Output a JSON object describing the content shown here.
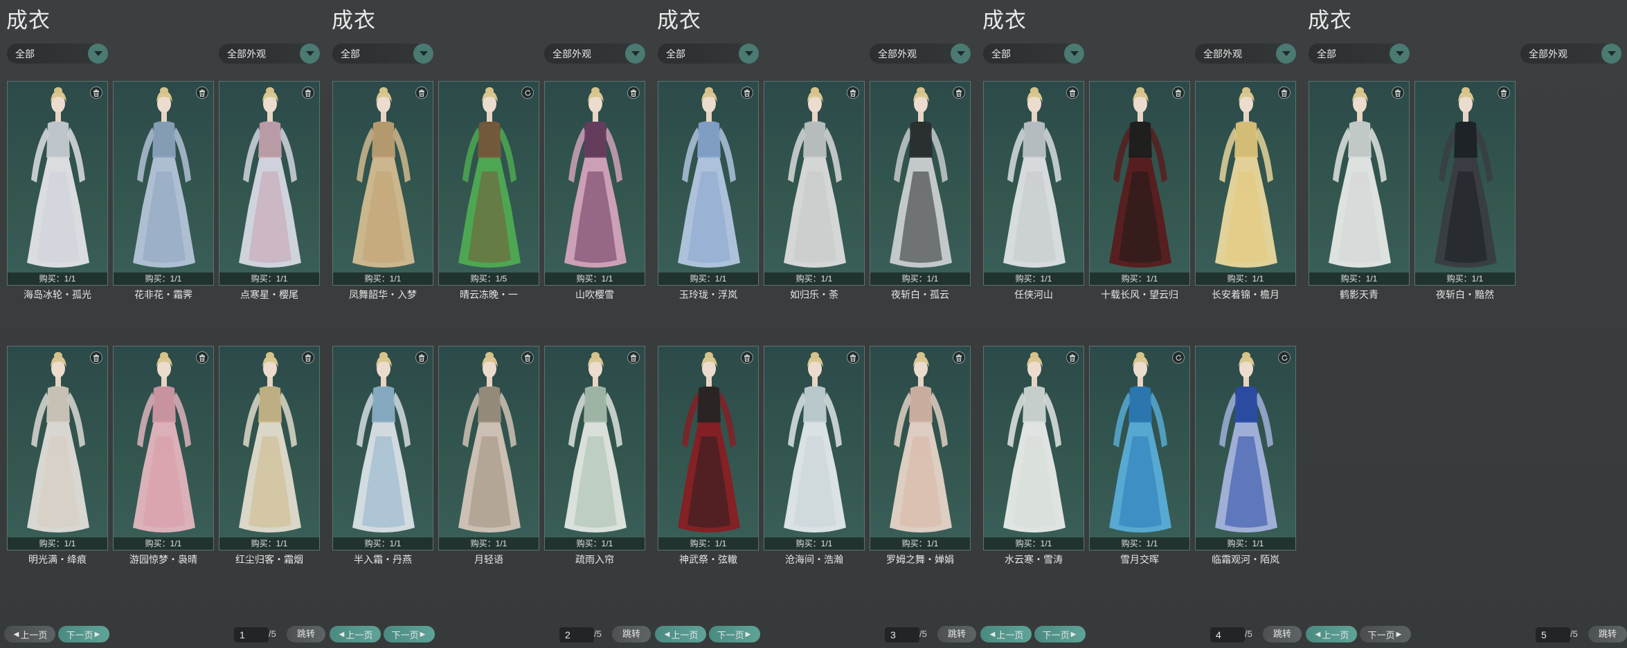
{
  "colors": {
    "background": "#3a3d3e",
    "card_bg": "#2f504c",
    "accent_teal": "#4a7a72",
    "next_button": "#5fa398"
  },
  "icons": {
    "trash_badge": "trash-icon",
    "refresh_badge": "refresh-icon",
    "dropdown": "chevron-down-icon"
  },
  "panels": [
    {
      "title": "成衣",
      "filter_category": "全部",
      "filter_appearance": "全部外观",
      "page_current": "1",
      "page_total": "/5",
      "prev_label": "上一页",
      "next_label": "下一页",
      "jump_label": "跳转",
      "active_nav": "next",
      "items": [
        {
          "name": "海岛冰轮・孤光",
          "purchase": "购买：1/1",
          "badge": "trash",
          "palette": [
            "#e8e8ec",
            "#cdd0d8"
          ]
        },
        {
          "name": "花非花・霜霁",
          "purchase": "购买：1/1",
          "badge": "trash",
          "palette": [
            "#b9c8dc",
            "#8ea4c0"
          ]
        },
        {
          "name": "点寒星・樱尾",
          "purchase": "购买：1/1",
          "badge": "trash",
          "palette": [
            "#dcdde8",
            "#c9a3b0"
          ]
        },
        {
          "name": "明光满・绛痕",
          "purchase": "购买：1/1",
          "badge": "trash",
          "palette": [
            "#e6e2dc",
            "#d8ccc0"
          ]
        },
        {
          "name": "游园惊梦・袅晴",
          "purchase": "购买：1/1",
          "badge": "trash",
          "palette": [
            "#e9b9c2",
            "#d89aa8"
          ]
        },
        {
          "name": "红尘归客・霜烟",
          "purchase": "购买：1/1",
          "badge": "trash",
          "palette": [
            "#e8e2d2",
            "#cdb98a"
          ]
        }
      ]
    },
    {
      "title": "成衣",
      "filter_category": "全部",
      "filter_appearance": "全部外观",
      "page_current": "2",
      "page_total": "/5",
      "prev_label": "上一页",
      "next_label": "下一页",
      "jump_label": "跳转",
      "active_nav": "both",
      "items": [
        {
          "name": "凤舞韶华・入梦",
          "purchase": "购买：1/1",
          "badge": "trash",
          "palette": [
            "#d8bf92",
            "#c2a272"
          ]
        },
        {
          "name": "晴云冻晚・一",
          "purchase": "购买：1/5",
          "badge": "refresh",
          "palette": [
            "#4fae52",
            "#7a5a3a"
          ]
        },
        {
          "name": "山吹樱雪",
          "purchase": "购买：1/1",
          "badge": "trash",
          "palette": [
            "#d9a6bf",
            "#6a3a5e"
          ]
        },
        {
          "name": "半入霜・丹燕",
          "purchase": "购买：1/1",
          "badge": "trash",
          "palette": [
            "#dfe6ec",
            "#8eb2cc"
          ]
        },
        {
          "name": "月轻语",
          "purchase": "购买：1/1",
          "badge": "trash",
          "palette": [
            "#d9c9bd",
            "#a09080"
          ]
        },
        {
          "name": "疏雨入帘",
          "purchase": "购买：1/1",
          "badge": "trash",
          "palette": [
            "#e8ece6",
            "#aabfae"
          ]
        }
      ]
    },
    {
      "title": "成衣",
      "filter_category": "全部",
      "filter_appearance": "全部外观",
      "page_current": "3",
      "page_total": "/5",
      "prev_label": "上一页",
      "next_label": "下一页",
      "jump_label": "跳转",
      "active_nav": "both",
      "items": [
        {
          "name": "玉玲珑・浮岚",
          "purchase": "购买：1/1",
          "badge": "trash",
          "palette": [
            "#b7cbe6",
            "#8aa6d0"
          ]
        },
        {
          "name": "如归乐・荼",
          "purchase": "购买：1/1",
          "badge": "trash",
          "palette": [
            "#e2e2e2",
            "#c4c8c8"
          ]
        },
        {
          "name": "夜斩白・孤云",
          "purchase": "购买：1/1",
          "badge": "trash",
          "palette": [
            "#cfd2d4",
            "#2a2c2e"
          ]
        },
        {
          "name": "神武祭・弦轍",
          "purchase": "购买：1/1",
          "badge": "trash",
          "palette": [
            "#8a1c22",
            "#2a2020"
          ]
        },
        {
          "name": "沧海间・浩瀚",
          "purchase": "购买：1/1",
          "badge": "trash",
          "palette": [
            "#e8eef0",
            "#c8d4d8"
          ]
        },
        {
          "name": "罗姆之舞・婵娟",
          "purchase": "购买：1/1",
          "badge": "trash",
          "palette": [
            "#ecd8cc",
            "#d9b6a6"
          ]
        }
      ]
    },
    {
      "title": "成衣",
      "filter_category": "全部",
      "filter_appearance": "全部外观",
      "page_current": "4",
      "page_total": "/5",
      "prev_label": "上一页",
      "next_label": "下一页",
      "jump_label": "跳转",
      "active_nav": "both",
      "items": [
        {
          "name": "任侠河山",
          "purchase": "购买：1/1",
          "badge": "trash",
          "palette": [
            "#e4e6e8",
            "#c4c8cc"
          ]
        },
        {
          "name": "十载长风・望云归",
          "purchase": "购买：1/1",
          "badge": "trash",
          "palette": [
            "#5a1a1c",
            "#1e1a1a"
          ]
        },
        {
          "name": "长安着锦・檐月",
          "purchase": "购买：1/1",
          "badge": "trash",
          "palette": [
            "#f0dca0",
            "#e6c87a"
          ]
        },
        {
          "name": "水云寒・雪涛",
          "purchase": "购买：1/1",
          "badge": "trash",
          "palette": [
            "#eef0ee",
            "#d6dcd8"
          ]
        },
        {
          "name": "雪月交晖",
          "purchase": "购买：1/1",
          "badge": "refresh",
          "palette": [
            "#5ab0dc",
            "#2a7ab8"
          ]
        },
        {
          "name": "临霜观河・陌岚",
          "purchase": "购买：1/1",
          "badge": "refresh",
          "palette": [
            "#a8b6e2",
            "#2a4aa8"
          ]
        }
      ]
    },
    {
      "title": "成衣",
      "filter_category": "全部",
      "filter_appearance": "全部外观",
      "page_current": "5",
      "page_total": "/5",
      "prev_label": "上一页",
      "next_label": "下一页",
      "jump_label": "跳转",
      "active_nav": "prev",
      "items": [
        {
          "name": "鹤影天青",
          "purchase": "购买：1/1",
          "badge": "trash",
          "palette": [
            "#eceeec",
            "#d2d6d4"
          ]
        },
        {
          "name": "夜斩白・黯然",
          "purchase": "购买：1/1",
          "badge": "trash",
          "palette": [
            "#3a3c42",
            "#1c1e22"
          ]
        }
      ]
    }
  ]
}
